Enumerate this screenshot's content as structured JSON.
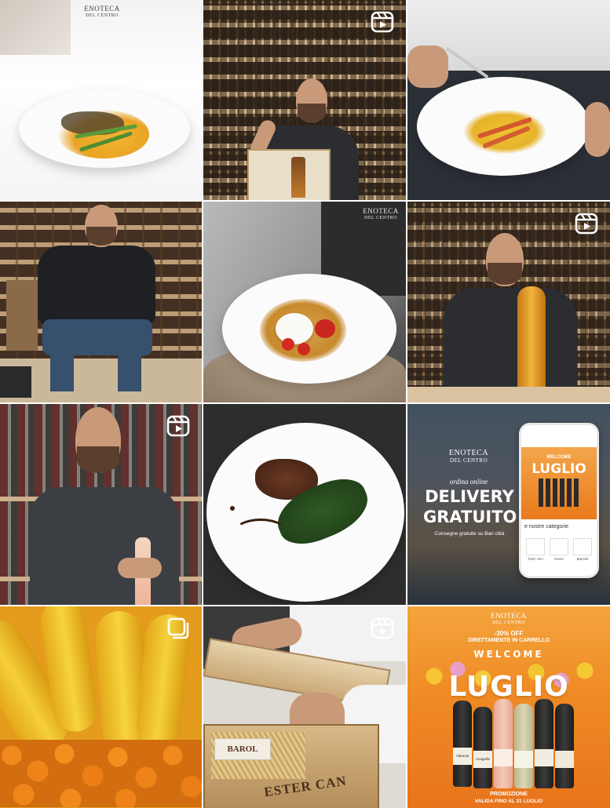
{
  "grid": {
    "tiles": [
      {
        "id": 1,
        "kind": "post",
        "logo_line1": "ENOTECA",
        "logo_line2": "DEL CENTRO"
      },
      {
        "id": 2,
        "kind": "reel"
      },
      {
        "id": 3,
        "kind": "post"
      },
      {
        "id": 4,
        "kind": "post"
      },
      {
        "id": 5,
        "kind": "reel",
        "logo_line1": "ENOTECA",
        "logo_line2": "DEL CENTRO"
      },
      {
        "id": 6,
        "kind": "reel"
      },
      {
        "id": 7,
        "kind": "reel"
      },
      {
        "id": 8,
        "kind": "post"
      },
      {
        "id": 9,
        "kind": "post",
        "logo_line1": "ENOTECA",
        "logo_line2": "DEL CENTRO",
        "kicker": "ordina online",
        "headline1": "DELIVERY",
        "headline2": "GRATUITO",
        "subline": "Consegne gratuite su Bari città",
        "phone_welcome": "WELCOME",
        "phone_month": "LUGLIO",
        "phone_categories": "e nostre categorie",
        "phone_cat_1": "Tutti i Vini",
        "phone_cat_2": "Rossi",
        "phone_cat_3": "Bianchi"
      },
      {
        "id": 10,
        "kind": "carousel"
      },
      {
        "id": 11,
        "kind": "reel",
        "crate_text": "ESTER CAN",
        "bottle_label": "BAROL"
      },
      {
        "id": 12,
        "kind": "post",
        "logo_line1": "ENOTECA",
        "logo_line2": "DEL CENTRO",
        "promo_line1": "-30% OFF",
        "promo_line2": "DIRETTAMENTE IN CARRELLO",
        "welcome": "WELCOME",
        "month": "LUGLIO",
        "footer1": "PROMOZIONE",
        "footer2": "VALIDA FINO AL 31 LUGLIO",
        "bottle_labels": [
          "Albarola",
          "Anagallis",
          "",
          "",
          "",
          ""
        ]
      }
    ]
  },
  "colors": {
    "promo_orange": "#e8741c",
    "cream": "#f6efe3"
  },
  "icons": {
    "reel": "reel-icon",
    "carousel": "carousel-icon"
  }
}
